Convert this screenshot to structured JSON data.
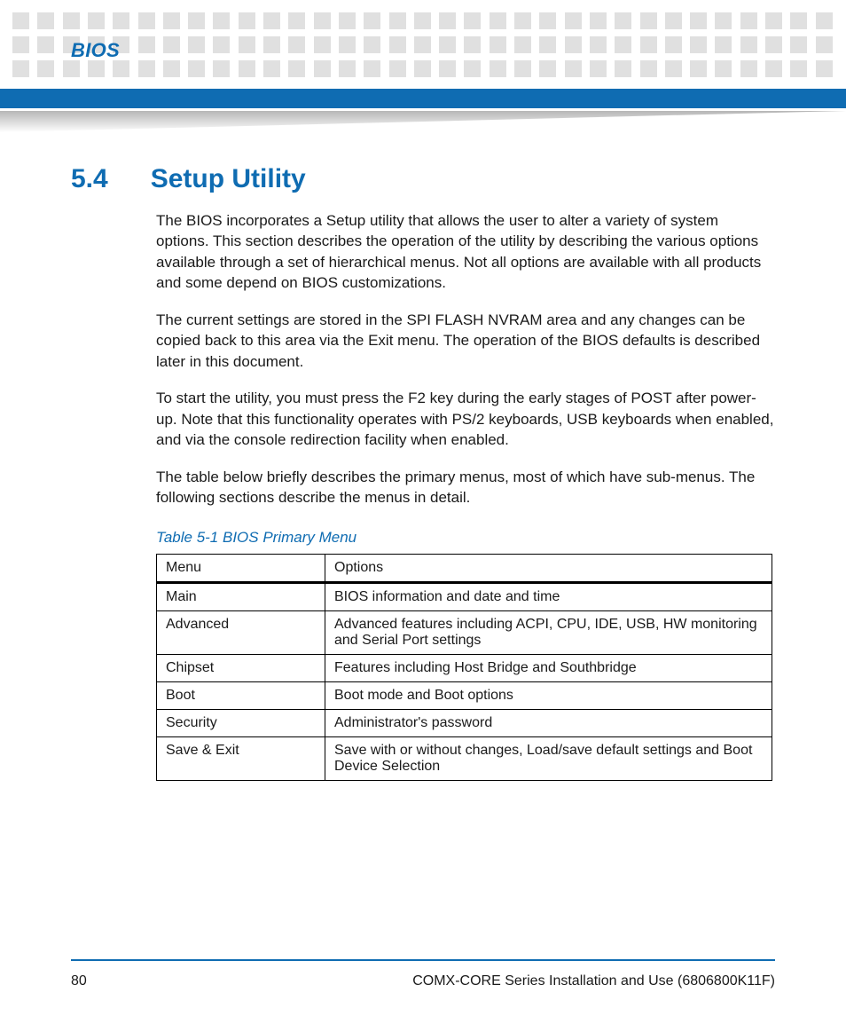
{
  "header": {
    "chapter_label": "BIOS"
  },
  "section": {
    "number": "5.4",
    "title": "Setup Utility"
  },
  "paragraphs": {
    "p1": "The BIOS incorporates a Setup utility that allows the user to alter a variety of system options. This section describes the operation of the utility by describing the various options available through a set of hierarchical menus. Not all options are available with all products and some depend on BIOS customizations.",
    "p2": "The current settings are stored in the SPI FLASH NVRAM area and any changes can be copied back to this area via the Exit menu. The operation of the BIOS defaults is described later in this document.",
    "p3": "To start the utility, you must press the F2 key during the early stages of POST after power-up. Note that this functionality operates with PS/2 keyboards, USB keyboards when enabled, and via the console redirection facility when enabled.",
    "p4": "The table below briefly describes the primary menus, most of which have sub-menus. The following sections describe the menus in detail."
  },
  "table": {
    "caption": "Table 5-1 BIOS Primary Menu",
    "head_col1": "Menu",
    "head_col2": "Options",
    "rows": [
      {
        "menu": "Main",
        "options": "BIOS information and date and time"
      },
      {
        "menu": "Advanced",
        "options": "Advanced features including ACPI, CPU, IDE, USB, HW monitoring and Serial Port settings"
      },
      {
        "menu": "Chipset",
        "options": "Features including Host Bridge and Southbridge"
      },
      {
        "menu": "Boot",
        "options": "Boot mode and Boot options"
      },
      {
        "menu": "Security",
        "options": "Administrator's password"
      },
      {
        "menu": "Save & Exit",
        "options": "Save with or without changes, Load/save default settings and Boot Device Selection"
      }
    ]
  },
  "footer": {
    "page_number": "80",
    "doc_title": "COMX-CORE Series Installation and Use (6806800K11F)"
  }
}
